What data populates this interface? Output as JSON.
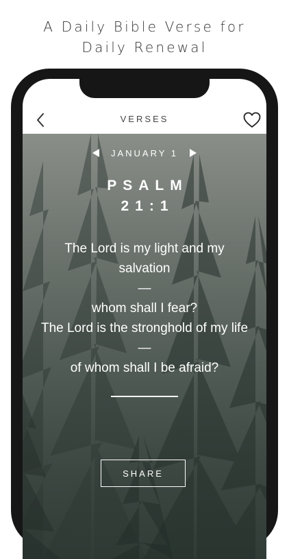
{
  "headline": {
    "line1": "A Daily Bible Verse for",
    "line2": "Daily Renewal"
  },
  "nav": {
    "title": "VERSES",
    "back_icon": "chevron-left-icon",
    "favorite_icon": "heart-outline-icon"
  },
  "verse_card": {
    "date": "JANUARY 1",
    "prev_icon": "triangle-left-icon",
    "next_icon": "triangle-right-icon",
    "book": "PSALM",
    "reference": "21:1",
    "lines": [
      "The Lord is my light and my",
      "salvation",
      "—",
      "whom shall I fear?",
      "The Lord is the stronghold of my life",
      "—",
      "of whom shall I be afraid?"
    ],
    "share_label": "SHARE"
  },
  "colors": {
    "phone_frame": "#161616",
    "text_on_image": "#ffffff",
    "headline_text": "#333333"
  }
}
